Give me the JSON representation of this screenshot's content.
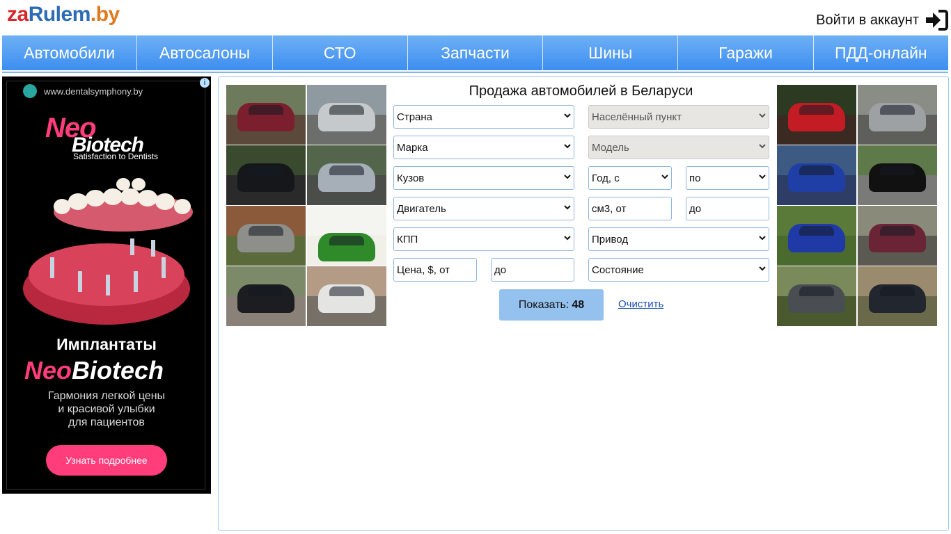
{
  "logo": {
    "part1": "za",
    "part2": "Rulem",
    "part3": ".by"
  },
  "login": {
    "label": "Войти в аккаунт",
    "icon": "sign-in-icon"
  },
  "nav": [
    {
      "label": "Автомобили"
    },
    {
      "label": "Автосалоны"
    },
    {
      "label": "СТО"
    },
    {
      "label": "Запчасти"
    },
    {
      "label": "Шины"
    },
    {
      "label": "Гаражи"
    },
    {
      "label": "ПДД-онлайн"
    }
  ],
  "ad": {
    "site": "www.dentalsymphony.by",
    "brand_top": "Neo",
    "brand_bottom": "Biotech",
    "tagline": "Satisfaction to Dentists",
    "headline": "Имплантаты",
    "brand2_a": "Neo",
    "brand2_b": "Biotech",
    "desc_line1": "Гармония легкой цены",
    "desc_line2": "и красивой улыбки",
    "desc_line3": "для пациентов",
    "cta": "Узнать подробнее",
    "info": "i"
  },
  "search": {
    "title": "Продажа автомобилей в Беларуси",
    "country": "Страна",
    "city": "Населённый пункт",
    "brand": "Марка",
    "model": "Модель",
    "body": "Кузов",
    "year_from": "Год, с",
    "year_to": "по",
    "engine": "Двигатель",
    "cc_from": "см3, от",
    "cc_to": "до",
    "gearbox": "КПП",
    "drive": "Привод",
    "price_from": "Цена, $, от",
    "price_to": "до",
    "condition": "Состояние",
    "show_label": "Показать:",
    "show_count": "48",
    "clear_label": "Очистить"
  },
  "colors": {
    "nav_top": "#6eb0f5",
    "nav_bottom": "#3d8ef0",
    "accent_border": "#8fb5e0",
    "show_button": "#94c1ee",
    "ad_pink": "#ff3d7a"
  }
}
